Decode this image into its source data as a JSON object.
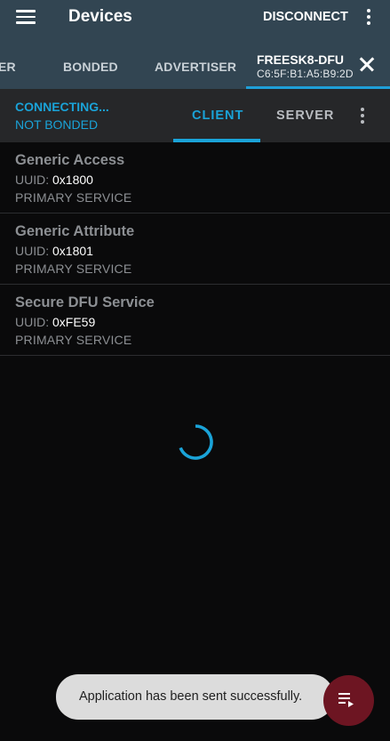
{
  "appbar": {
    "title": "Devices",
    "disconnect_label": "DISCONNECT"
  },
  "device_tabs": {
    "scanner_label": "ER",
    "bonded_label": "BONDED",
    "advertiser_label": "ADVERTISER",
    "active_device": {
      "name": "FREESK8-DFU",
      "address": "C6:5F:B1:A5:B9:2D"
    }
  },
  "status": {
    "connection": "CONNECTING...",
    "bond": "NOT BONDED"
  },
  "mode_tabs": {
    "client_label": "CLIENT",
    "server_label": "SERVER",
    "selected": "CLIENT"
  },
  "services": [
    {
      "name": "Generic Access",
      "uuid_label": "UUID:",
      "uuid": "0x1800",
      "type": "PRIMARY SERVICE"
    },
    {
      "name": "Generic Attribute",
      "uuid_label": "UUID:",
      "uuid": "0x1801",
      "type": "PRIMARY SERVICE"
    },
    {
      "name": "Secure DFU Service",
      "uuid_label": "UUID:",
      "uuid": "0xFE59",
      "type": "PRIMARY SERVICE"
    }
  ],
  "snackbar": {
    "message": "Application has been sent successfully."
  },
  "colors": {
    "appbar": "#324552",
    "accent": "#1aa3d8",
    "fab": "#6d1522",
    "background": "#0a0a0b"
  },
  "icons": {
    "menu": "menu-icon",
    "overflow": "more-vert-icon",
    "close": "close-icon",
    "fab": "playlist-play-icon"
  }
}
